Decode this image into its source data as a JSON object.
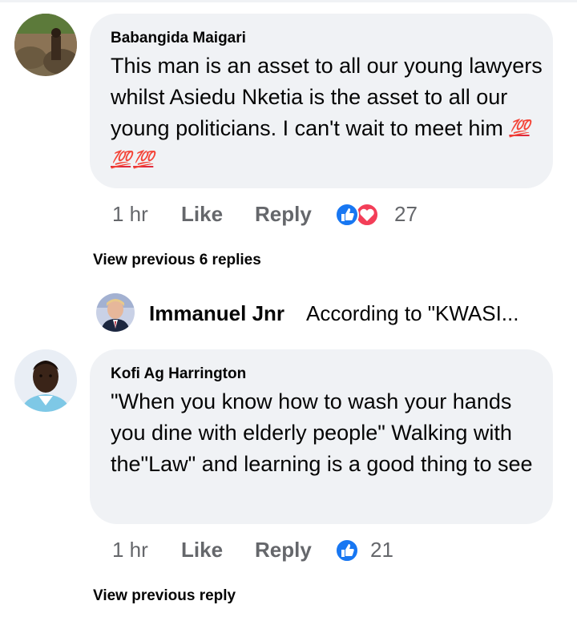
{
  "comments": [
    {
      "author": "Babangida Maigari",
      "text": "This man is an asset to all our young lawyers whilst Asiedu Nketia is the asset to all our young politicians. I can't wait to meet him",
      "emoji": [
        "💯",
        "💯",
        "💯"
      ],
      "time": "1 hr",
      "like_label": "Like",
      "reply_label": "Reply",
      "reactions": [
        "like-icon",
        "love-icon"
      ],
      "reaction_count": "27",
      "view_replies": "View previous 6 replies"
    },
    {
      "author": "Kofi Ag Harrington",
      "text": "\"When you know how to wash your hands you dine with elderly people\" Walking with the\"Law\" and learning is a good thing to see",
      "time": "1 hr",
      "like_label": "Like",
      "reply_label": "Reply",
      "reactions": [
        "like-icon"
      ],
      "reaction_count": "21",
      "view_replies": "View previous reply"
    }
  ],
  "reply_preview": {
    "author": "Immanuel Jnr",
    "text": "According to \"KWASI..."
  },
  "colors": {
    "bubble": "#f0f2f5",
    "secondary_text": "#65676b",
    "like_blue": "#1877f2",
    "love_red": "#f33e58"
  }
}
